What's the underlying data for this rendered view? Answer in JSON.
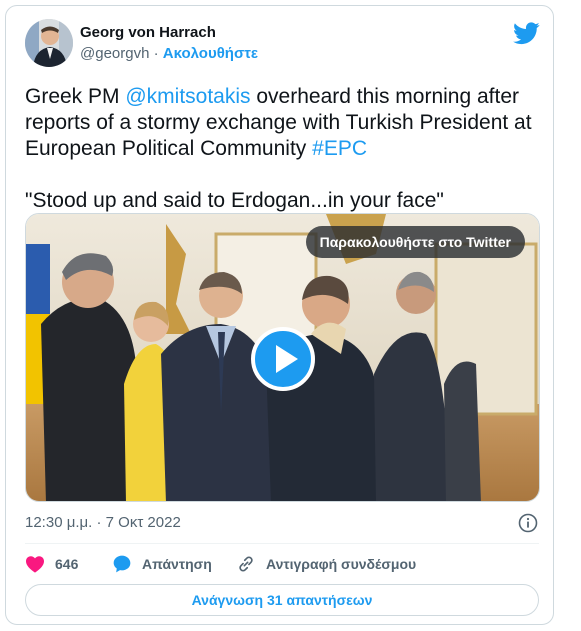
{
  "author": {
    "name": "Georg von Harrach",
    "handle": "@georgvh",
    "separator": "·",
    "follow_label": "Ακολουθήστε"
  },
  "tweet": {
    "text_part1": "Greek PM ",
    "mention": "@kmitsotakis",
    "text_part2": " overheard this morning after reports of a stormy exchange with Turkish President at European Political Community ",
    "hashtag": "#EPC",
    "quote": "\"Stood up and said to Erdogan...in your face\""
  },
  "media": {
    "watch_label": "Παρακολουθήστε στο Twitter"
  },
  "meta": {
    "timestamp": "12:30 μ.μ. · 7 Οκτ 2022"
  },
  "actions": {
    "like_count": "646",
    "reply_label": "Απάντηση",
    "copy_label": "Αντιγραφή συνδέσμου"
  },
  "read_replies_label": "Ανάγνωση 31 απαντήσεων",
  "colors": {
    "accent": "#1d9bf0",
    "like": "#f91880",
    "secondary_text": "#536471",
    "border": "#cfd9de"
  },
  "icons": [
    "twitter-bird-icon",
    "play-icon",
    "info-icon",
    "heart-icon",
    "reply-bubble-icon",
    "link-icon"
  ]
}
